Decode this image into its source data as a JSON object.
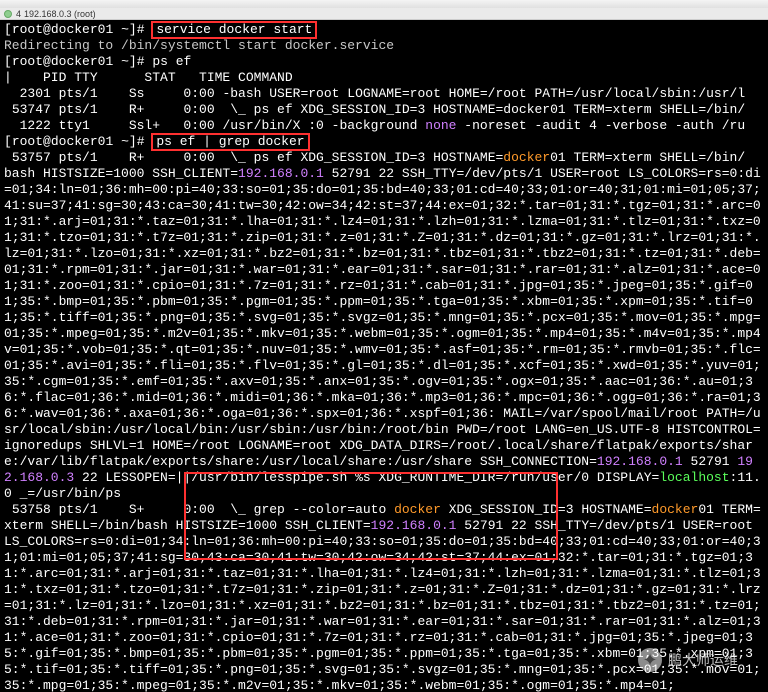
{
  "tab": {
    "index": "4",
    "title": "192.168.0.3 (root)"
  },
  "prompt": {
    "user": "root",
    "host": "docker01",
    "cwd": "~",
    "symbol": "#"
  },
  "cmds": {
    "c1": "service docker start",
    "c1_out": "Redirecting to /bin/systemctl start docker.service",
    "c2": "ps ef",
    "c3": "ps ef | grep docker"
  },
  "ps_header": "|    PID TTY      STAT   TIME COMMAND",
  "ps_rows": [
    "  2301 pts/1    Ss     0:00 -bash USER=root LOGNAME=root HOME=/root PATH=/usr/local/sbin:/usr/l",
    " 53747 pts/1    R+     0:00  \\_ ps ef XDG_SESSION_ID=3 HOSTNAME=docker01 TERM=xterm SHELL=/bin/"
  ],
  "ps_none_row": {
    "a": "  1222 tty1     Ssl+   0:00 /usr/bin/X :0 -background ",
    "none": "none",
    "b": " -noreset -audit 4 -verbose -auth /ru"
  },
  "grep_head": {
    "a": " 53757 pts/1    R+     0:00  \\_ ps ef XDG_SESSION_ID=3 HOSTNAME=",
    "d": "docker",
    "b": "01 TERM=xterm SHELL=/bin/"
  },
  "env_pre": "bash HISTSIZE=1000 SSH_CLIENT=",
  "ssh_ip": "192.168.0.1",
  "env_post": " 52791 22 SSH_TTY=/dev/pts/1 USER=root LS_COLORS=rs=0:",
  "ls_colors_block": "di=01;34:ln=01;36:mh=00:pi=40;33:so=01;35:do=01;35:bd=40;33;01:cd=40;33;01:or=40;31;01:mi=01;05;37;41:su=37;41:sg=30;43:ca=30;41:tw=30;42:ow=34;42:st=37;44:ex=01;32:*.tar=01;31:*.tgz=01;31:*.arc=01;31:*.arj=01;31:*.taz=01;31:*.lha=01;31:*.lz4=01;31:*.lzh=01;31:*.lzma=01;31:*.tlz=01;31:*.txz=01;31:*.tzo=01;31:*.t7z=01;31:*.zip=01;31:*.z=01;31:*.Z=01;31:*.dz=01;31:*.gz=01;31:*.lrz=01;31:*.lz=01;31:*.lzo=01;31:*.xz=01;31:*.bz2=01;31:*.bz=01;31:*.tbz=01;31:*.tbz2=01;31:*.tz=01;31:*.deb=01;31:*.rpm=01;31:*.jar=01;31:*.war=01;31:*.ear=01;31:*.sar=01;31:*.rar=01;31:*.alz=01;31:*.ace=01;31:*.zoo=01;31:*.cpio=01;31:*.7z=01;31:*.rz=01;31:*.cab=01;31:*.jpg=01;35:*.jpeg=01;35:*.gif=01;35:*.bmp=01;35:*.pbm=01;35:*.pgm=01;35:*.ppm=01;35:*.tga=01;35:*.xbm=01;35:*.xpm=01;35:*.tif=01;35:*.tiff=01;35:*.png=01;35:*.svg=01;35:*.svgz=01;35:*.mng=01;35:*.pcx=01;35:*.mov=01;35:*.mpg=01;35:*.mpeg=01;35:*.m2v=01;35:*.mkv=01;35:*.webm=01;35:*.ogm=01;35:*.mp4=01;35:*.m4v=01;35:*.mp4v=01;35:*.vob=01;35:*.qt=01;35:*.nuv=01;35:*.wmv=01;35:*.asf=01;35:*.rm=01;35:*.rmvb=01;35:*.flc=01;35:*.avi=01;35:*.fli=01;35:*.flv=01;35:*.gl=01;35:*.dl=01;35:*.xcf=01;35:*.xwd=01;35:*.yuv=01;35:*.cgm=01;35:*.emf=01;35:*.axv=01;35:*.anx=01;35:*.ogv=01;35:*.ogx=01;35:*.aac=01;36:*.au=01;36:*.flac=01;36:*.mid=01;36:*.midi=01;36:*.mka=01;36:*.mp3=01;36:*.mpc=01;36:*.ogg=01;36:*.ra=01;36:*.wav=01;36:*.axa=01;36:*.oga=01;36:*.spx=01;36:*.xspf=01;36: MAIL=/var/spool/mail/root PATH=/usr/local/sbin:/usr/local/bin:/usr/sbin:/usr/bin:/root/bin PWD=/root LANG=en_US.UTF-8 HISTCONTROL=ignoredups SHLVL=1 HOME=/root LOGNAME=root XDG_DATA_DIRS=/root/.local/share/flatpak/exports/share:/var/lib/flatpak/exports/share:/usr/local/share:/usr/share SSH_CONNECTION=",
  "conn": {
    "ip1": "192.168.0.1",
    "mid": " 52791 ",
    "ip2": "192.168.0.3",
    "tail_a": " 22 LESSOPEN=||/usr/bin/lesspipe.sh %s XDG_RUNTIME_DIR=/run/user/0 DISPLAY=",
    "localhost": "localhost",
    "tail_b": ":11.0 _=/usr/bin/ps"
  },
  "grep2": {
    "a": " 53758 pts/1    S+     0:00  \\_ grep --color=auto ",
    "d": "docker",
    "b": " XDG_SESSION_ID=3 HOSTNAME=",
    "d2": "docker",
    "c": "01 TERM=xterm SHELL=/bin/bash HISTSIZE=1000 SSH_CLIENT=",
    "ip": "192.168.0.1",
    "e": " 52791 22 SSH_TTY=/dev/pts/1 USER=root LS_COLORS=rs=0:di=0"
  },
  "ls_colors_block2": "1;34:ln=01;36:mh=00:pi=40;33:so=01;35:do=01;35:bd=40;33;01:cd=40;33;01:or=40;31;01:mi=01;05;37;41:sg=30;43:ca=30;41:tw=30;42:ow=34;42:st=37;44:ex=01;32:*.tar=01;31:*.tgz=01;31:*.arc=01;31:*.arj=01;31:*.taz=01;31:*.lha=01;31:*.lz4=01;31:*.lzh=01;31:*.lzma=01;31:*.tlz=01;31:*.txz=01;31:*.tzo=01;31:*.t7z=01;31:*.zip=01;31:*.z=01;31:*.Z=01;31:*.dz=01;31:*.gz=01;31:*.lrz=01;31:*.lz=01;31:*.lzo=01;31:*.xz=01;31:*.bz2=01;31:*.bz=01;31:*.tbz=01;31:*.tbz2=01;31:*.tz=01;31:*.deb=01;31:*.rpm=01;31:*.jar=01;31:*.war=01;31:*.ear=01;31:*.sar=01;31:*.rar=01;31:*.alz=01;31:*.ace=01;31:*.zoo=01;31:*.cpio=01;31:*.7z=01;31:*.rz=01;31:*.cab=01;31:*.jpg=01;35:*.jpeg=01;35:*.gif=01;35:*.bmp=01;35:*.pbm=01;35:*.pgm=01;35:*.ppm=01;35:*.tga=01;35:*.xbm=01;35:*.xpm=01;35:*.tif=01;35:*.tiff=01;35:*.png=01;35:*.svg=01;35:*.svgz=01;35:*.mng=01;35:*.pcx=01;35:*.mov=01;35:*.mpg=01;35:*.mpeg=01;35:*.m2v=01;35:*.mkv=01;35:*.webm=01;35:*.ogm=01;35:*.mp4=01;",
  "watermark": "鹏大师运维"
}
